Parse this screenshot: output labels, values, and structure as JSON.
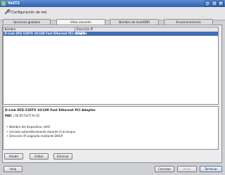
{
  "window": {
    "title": "YaST2",
    "controls": [
      "_",
      "□",
      "✕"
    ]
  },
  "header": {
    "title": "Configuración de red"
  },
  "tabs": [
    {
      "label": "Opciones globales",
      "active": false
    },
    {
      "label": "Vista resumen",
      "active": true
    },
    {
      "label": "Nombre de host/DNS",
      "active": false
    },
    {
      "label": "Encaminamiento",
      "active": false
    }
  ],
  "table": {
    "columns": [
      "Nombre",
      "Dirección IP"
    ],
    "rows": [
      {
        "name": "D-Link DFE-528TX 10/100 Fast Ethernet PCI Adapter",
        "ip": "DHCP"
      }
    ]
  },
  "details": {
    "title": "D-Link DFE-528TX 10/100 Fast Ethernet PCI Adapter",
    "mac_label": "MAC :",
    "mac_value": "00:05:5d:f7:fe:32",
    "bullets": [
      "Nombre del dispositivo: eth0",
      "Iniciado automáticamente durante el arranque",
      "Dirección IP asignada mediante DHCP"
    ]
  },
  "actions": {
    "add": "Añadir",
    "edit": "Editar",
    "delete": "Eliminar"
  },
  "footer": {
    "help": "Help",
    "cancel": "Cancelar",
    "back": "Atrás",
    "finish": "Terminar"
  }
}
